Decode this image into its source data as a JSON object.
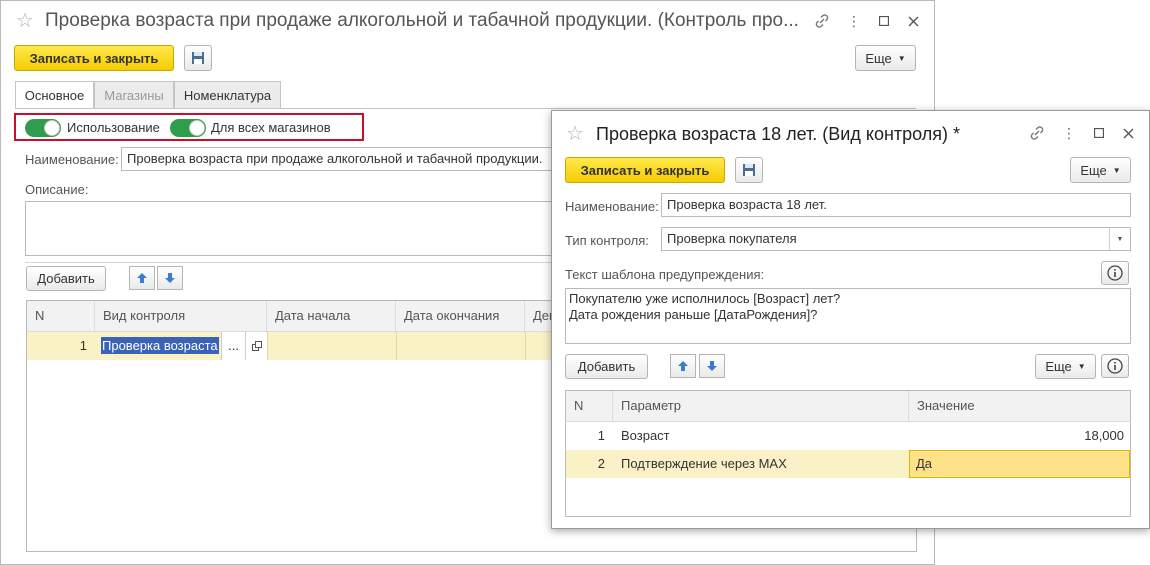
{
  "main_window": {
    "title": "Проверка возраста при продаже алкогольной и табачной продукции. (Контроль про...",
    "save_close_label": "Записать и закрыть",
    "more_label": "Еще",
    "tabs": [
      {
        "label": "Основное"
      },
      {
        "label": "Магазины"
      },
      {
        "label": "Номенклатура"
      }
    ],
    "toggle_usage_label": "Использование",
    "toggle_all_stores_label": "Для всех магазинов",
    "name_label": "Наименование:",
    "name_value": "Проверка возраста при продаже алкогольной и табачной продукции.",
    "description_label": "Описание:",
    "add_label": "Добавить",
    "table": {
      "columns": [
        "N",
        "Вид контроля",
        "Дата начала",
        "Дата окончания",
        "Ден"
      ],
      "rows": [
        {
          "n": "1",
          "kind": "Проверка возраста",
          "ellipsis": "..."
        }
      ]
    },
    "colors": {
      "accent_yellow": "#f5cc00",
      "toggle_on": "#2e9e4c",
      "highlight_border": "#c8102e",
      "row_highlight": "#fbf1c6"
    }
  },
  "dialog": {
    "title": "Проверка возраста 18 лет. (Вид контроля) *",
    "save_close_label": "Записать и закрыть",
    "more_label": "Еще",
    "name_label": "Наименование:",
    "name_value": "Проверка возраста 18 лет.",
    "control_type_label": "Тип контроля:",
    "control_type_value": "Проверка покупателя",
    "template_label": "Текст шаблона предупреждения:",
    "template_line1": "Покупателю уже исполнилось [Возраст] лет?",
    "template_line2": "Дата рождения раньше [ДатаРождения]?",
    "add_label": "Добавить",
    "more2_label": "Еще",
    "table": {
      "columns": [
        "N",
        "Параметр",
        "Значение"
      ],
      "rows": [
        {
          "n": "1",
          "param": "Возраст",
          "value": "18,000"
        },
        {
          "n": "2",
          "param": "Подтверждение через MAX",
          "value": "Да"
        }
      ]
    }
  }
}
